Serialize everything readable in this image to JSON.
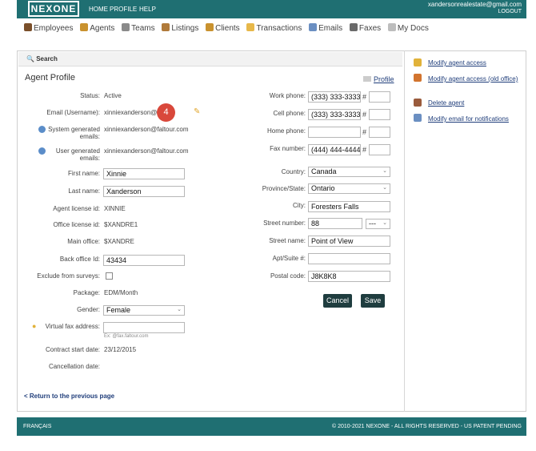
{
  "header": {
    "logo": "NEXONE",
    "nav": [
      "HOME",
      "PROFILE",
      "HELP"
    ],
    "user_email": "xandersonrealestate@gmail.com",
    "logout": "LOGOUT"
  },
  "mainnav": [
    {
      "label": "Employees",
      "icon": "employees-icon",
      "color": "#7a4f2a"
    },
    {
      "label": "Agents",
      "icon": "agents-icon",
      "color": "#c9922f"
    },
    {
      "label": "Teams",
      "icon": "teams-icon",
      "color": "#8a8a8a"
    },
    {
      "label": "Listings",
      "icon": "house-icon",
      "color": "#b07a3a"
    },
    {
      "label": "Clients",
      "icon": "clients-icon",
      "color": "#c9922f"
    },
    {
      "label": "Transactions",
      "icon": "folder-icon",
      "color": "#e7b84a"
    },
    {
      "label": "Emails",
      "icon": "envelope-icon",
      "color": "#6b8fc2"
    },
    {
      "label": "Faxes",
      "icon": "fax-icon",
      "color": "#6a6a6a"
    },
    {
      "label": "My Docs",
      "icon": "docs-icon",
      "color": "#bdbdbd"
    }
  ],
  "search": {
    "label": "Search"
  },
  "profile": {
    "title": "Agent Profile",
    "profile_link": "Profile",
    "badge": "4",
    "fields": {
      "status_label": "Status:",
      "status_value": "Active",
      "email_label": "Email (Username):",
      "email_value": "xinniexanderson@",
      "sys_emails_label": "System generated emails:",
      "sys_emails_value": "xinniexanderson@faltour.com",
      "user_emails_label": "User generated emails:",
      "user_emails_value": "xinniexanderson@faltour.com",
      "first_name_label": "First name:",
      "first_name_value": "Xinnie",
      "last_name_label": "Last name:",
      "last_name_value": "Xanderson",
      "license_label": "Agent license id:",
      "license_value": "XINNIE",
      "office_license_label": "Office license id:",
      "office_license_value": "$XANDRE1",
      "main_office_label": "Main office:",
      "main_office_value": "$XANDRE",
      "back_office_label": "Back office Id:",
      "back_office_value": "43434",
      "exclude_label": "Exclude from surveys:",
      "package_label": "Package:",
      "package_value": "EDM/Month",
      "gender_label": "Gender:",
      "gender_value": "Female",
      "fax_label": "Virtual fax address:",
      "fax_value": "",
      "fax_hint": "Ex: @fax.faltour.com",
      "contract_label": "Contract start date:",
      "contract_value": "23/12/2015",
      "cancel_label": "Cancellation date:"
    },
    "contact": {
      "work_label": "Work phone:",
      "work_value": "(333) 333-3333",
      "cell_label": "Cell phone:",
      "cell_value": "(333) 333-3333",
      "home_label": "Home phone:",
      "home_value": "",
      "fax_label": "Fax number:",
      "fax_value": "(444) 444-4444",
      "country_label": "Country:",
      "country_value": "Canada",
      "province_label": "Province/State:",
      "province_value": "Ontario",
      "city_label": "City:",
      "city_value": "Foresters Falls",
      "street_num_label": "Street number:",
      "street_num_value": "88",
      "street_suffix": "---",
      "street_name_label": "Street name:",
      "street_name_value": "Point of View",
      "apt_label": "Apt/Suite #:",
      "apt_value": "",
      "postal_label": "Postal code:",
      "postal_value": "J8K8K8",
      "hash": "#"
    },
    "buttons": {
      "cancel": "Cancel",
      "save": "Save"
    },
    "back_link": "< Return to the previous page"
  },
  "sidebar": [
    {
      "label": "Modify agent access",
      "icon": "lock-icon",
      "color": "#e1b23a"
    },
    {
      "label": "Modify agent access (old office)",
      "icon": "lock-edit-icon",
      "color": "#d2742f"
    },
    {
      "label": "Delete agent",
      "icon": "user-delete-icon",
      "color": "#9a5b3c"
    },
    {
      "label": "Modify email for notifications",
      "icon": "email-icon",
      "color": "#6b8fc2"
    }
  ],
  "footer": {
    "lang": "FRANÇAIS",
    "copyright": "© 2010-2021 NEXONE - ALL RIGHTS RESERVED - US PATENT PENDING"
  }
}
